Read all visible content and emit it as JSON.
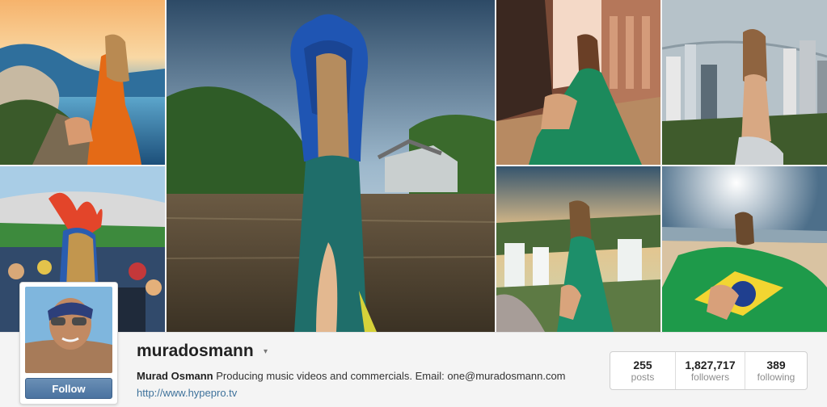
{
  "profile": {
    "username": "muradosmann",
    "caret": "▾",
    "full_name": "Murad Osmann",
    "bio": "Producing music videos and commercials. Email: one@muradosmann.com",
    "website": "http://www.hypepro.tv",
    "follow_label": "Follow"
  },
  "stats": [
    {
      "value": "255",
      "label": "posts"
    },
    {
      "value": "1,827,717",
      "label": "followers"
    },
    {
      "value": "389",
      "label": "following"
    }
  ],
  "colors": {
    "follow_button": "#4b73a0",
    "link": "#3f729b"
  }
}
